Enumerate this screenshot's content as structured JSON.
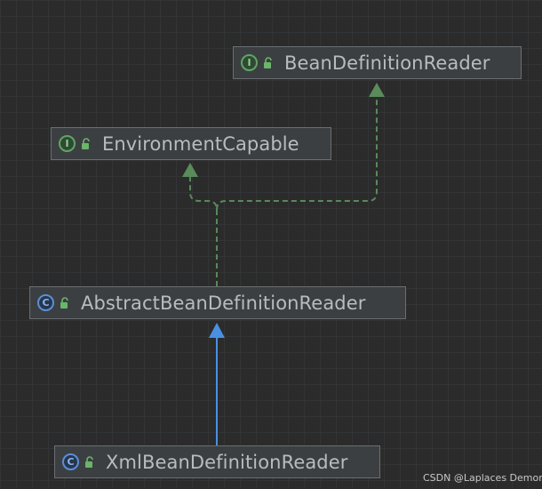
{
  "diagram": {
    "nodes": {
      "bean_definition_reader": {
        "label": "BeanDefinitionReader",
        "kind": "interface",
        "kind_glyph": "I"
      },
      "environment_capable": {
        "label": "EnvironmentCapable",
        "kind": "interface",
        "kind_glyph": "I"
      },
      "abstract_bean_definition_reader": {
        "label": "AbstractBeanDefinitionReader",
        "kind": "class",
        "kind_glyph": "C"
      },
      "xml_bean_definition_reader": {
        "label": "XmlBeanDefinitionReader",
        "kind": "class",
        "kind_glyph": "C"
      }
    },
    "edges": [
      {
        "from": "AbstractBeanDefinitionReader",
        "to": "EnvironmentCapable",
        "type": "implements"
      },
      {
        "from": "AbstractBeanDefinitionReader",
        "to": "BeanDefinitionReader",
        "type": "implements"
      },
      {
        "from": "XmlBeanDefinitionReader",
        "to": "AbstractBeanDefinitionReader",
        "type": "extends"
      }
    ],
    "colors": {
      "background": "#2b2b2b",
      "node_fill": "#3c3f41",
      "node_border": "#6b6e71",
      "text": "#b9bcbf",
      "implements_edge": "#59895a",
      "extends_edge": "#4a90e2",
      "interface_icon": "#5fa566",
      "class_icon": "#5a8fd6",
      "lock_icon": "#6ab56a"
    }
  },
  "watermark": {
    "text": "CSDN @Laplaces Demon"
  }
}
